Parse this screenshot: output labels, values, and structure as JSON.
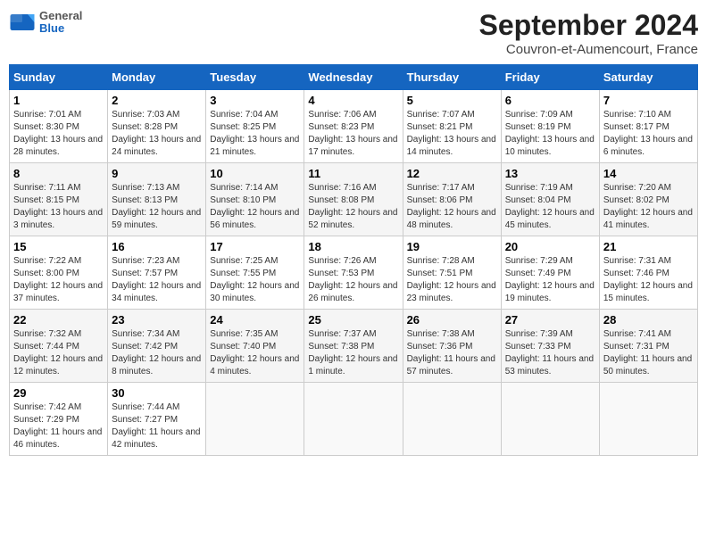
{
  "header": {
    "logo_general": "General",
    "logo_blue": "Blue",
    "title": "September 2024",
    "subtitle": "Couvron-et-Aumencourt, France"
  },
  "calendar": {
    "days_of_week": [
      "Sunday",
      "Monday",
      "Tuesday",
      "Wednesday",
      "Thursday",
      "Friday",
      "Saturday"
    ],
    "weeks": [
      [
        {
          "day": "1",
          "info": "Sunrise: 7:01 AM\nSunset: 8:30 PM\nDaylight: 13 hours\nand 28 minutes."
        },
        {
          "day": "2",
          "info": "Sunrise: 7:03 AM\nSunset: 8:28 PM\nDaylight: 13 hours\nand 24 minutes."
        },
        {
          "day": "3",
          "info": "Sunrise: 7:04 AM\nSunset: 8:25 PM\nDaylight: 13 hours\nand 21 minutes."
        },
        {
          "day": "4",
          "info": "Sunrise: 7:06 AM\nSunset: 8:23 PM\nDaylight: 13 hours\nand 17 minutes."
        },
        {
          "day": "5",
          "info": "Sunrise: 7:07 AM\nSunset: 8:21 PM\nDaylight: 13 hours\nand 14 minutes."
        },
        {
          "day": "6",
          "info": "Sunrise: 7:09 AM\nSunset: 8:19 PM\nDaylight: 13 hours\nand 10 minutes."
        },
        {
          "day": "7",
          "info": "Sunrise: 7:10 AM\nSunset: 8:17 PM\nDaylight: 13 hours\nand 6 minutes."
        }
      ],
      [
        {
          "day": "8",
          "info": "Sunrise: 7:11 AM\nSunset: 8:15 PM\nDaylight: 13 hours\nand 3 minutes."
        },
        {
          "day": "9",
          "info": "Sunrise: 7:13 AM\nSunset: 8:13 PM\nDaylight: 12 hours\nand 59 minutes."
        },
        {
          "day": "10",
          "info": "Sunrise: 7:14 AM\nSunset: 8:10 PM\nDaylight: 12 hours\nand 56 minutes."
        },
        {
          "day": "11",
          "info": "Sunrise: 7:16 AM\nSunset: 8:08 PM\nDaylight: 12 hours\nand 52 minutes."
        },
        {
          "day": "12",
          "info": "Sunrise: 7:17 AM\nSunset: 8:06 PM\nDaylight: 12 hours\nand 48 minutes."
        },
        {
          "day": "13",
          "info": "Sunrise: 7:19 AM\nSunset: 8:04 PM\nDaylight: 12 hours\nand 45 minutes."
        },
        {
          "day": "14",
          "info": "Sunrise: 7:20 AM\nSunset: 8:02 PM\nDaylight: 12 hours\nand 41 minutes."
        }
      ],
      [
        {
          "day": "15",
          "info": "Sunrise: 7:22 AM\nSunset: 8:00 PM\nDaylight: 12 hours\nand 37 minutes."
        },
        {
          "day": "16",
          "info": "Sunrise: 7:23 AM\nSunset: 7:57 PM\nDaylight: 12 hours\nand 34 minutes."
        },
        {
          "day": "17",
          "info": "Sunrise: 7:25 AM\nSunset: 7:55 PM\nDaylight: 12 hours\nand 30 minutes."
        },
        {
          "day": "18",
          "info": "Sunrise: 7:26 AM\nSunset: 7:53 PM\nDaylight: 12 hours\nand 26 minutes."
        },
        {
          "day": "19",
          "info": "Sunrise: 7:28 AM\nSunset: 7:51 PM\nDaylight: 12 hours\nand 23 minutes."
        },
        {
          "day": "20",
          "info": "Sunrise: 7:29 AM\nSunset: 7:49 PM\nDaylight: 12 hours\nand 19 minutes."
        },
        {
          "day": "21",
          "info": "Sunrise: 7:31 AM\nSunset: 7:46 PM\nDaylight: 12 hours\nand 15 minutes."
        }
      ],
      [
        {
          "day": "22",
          "info": "Sunrise: 7:32 AM\nSunset: 7:44 PM\nDaylight: 12 hours\nand 12 minutes."
        },
        {
          "day": "23",
          "info": "Sunrise: 7:34 AM\nSunset: 7:42 PM\nDaylight: 12 hours\nand 8 minutes."
        },
        {
          "day": "24",
          "info": "Sunrise: 7:35 AM\nSunset: 7:40 PM\nDaylight: 12 hours\nand 4 minutes."
        },
        {
          "day": "25",
          "info": "Sunrise: 7:37 AM\nSunset: 7:38 PM\nDaylight: 12 hours\nand 1 minute."
        },
        {
          "day": "26",
          "info": "Sunrise: 7:38 AM\nSunset: 7:36 PM\nDaylight: 11 hours\nand 57 minutes."
        },
        {
          "day": "27",
          "info": "Sunrise: 7:39 AM\nSunset: 7:33 PM\nDaylight: 11 hours\nand 53 minutes."
        },
        {
          "day": "28",
          "info": "Sunrise: 7:41 AM\nSunset: 7:31 PM\nDaylight: 11 hours\nand 50 minutes."
        }
      ],
      [
        {
          "day": "29",
          "info": "Sunrise: 7:42 AM\nSunset: 7:29 PM\nDaylight: 11 hours\nand 46 minutes."
        },
        {
          "day": "30",
          "info": "Sunrise: 7:44 AM\nSunset: 7:27 PM\nDaylight: 11 hours\nand 42 minutes."
        },
        {
          "day": "",
          "info": ""
        },
        {
          "day": "",
          "info": ""
        },
        {
          "day": "",
          "info": ""
        },
        {
          "day": "",
          "info": ""
        },
        {
          "day": "",
          "info": ""
        }
      ]
    ]
  }
}
